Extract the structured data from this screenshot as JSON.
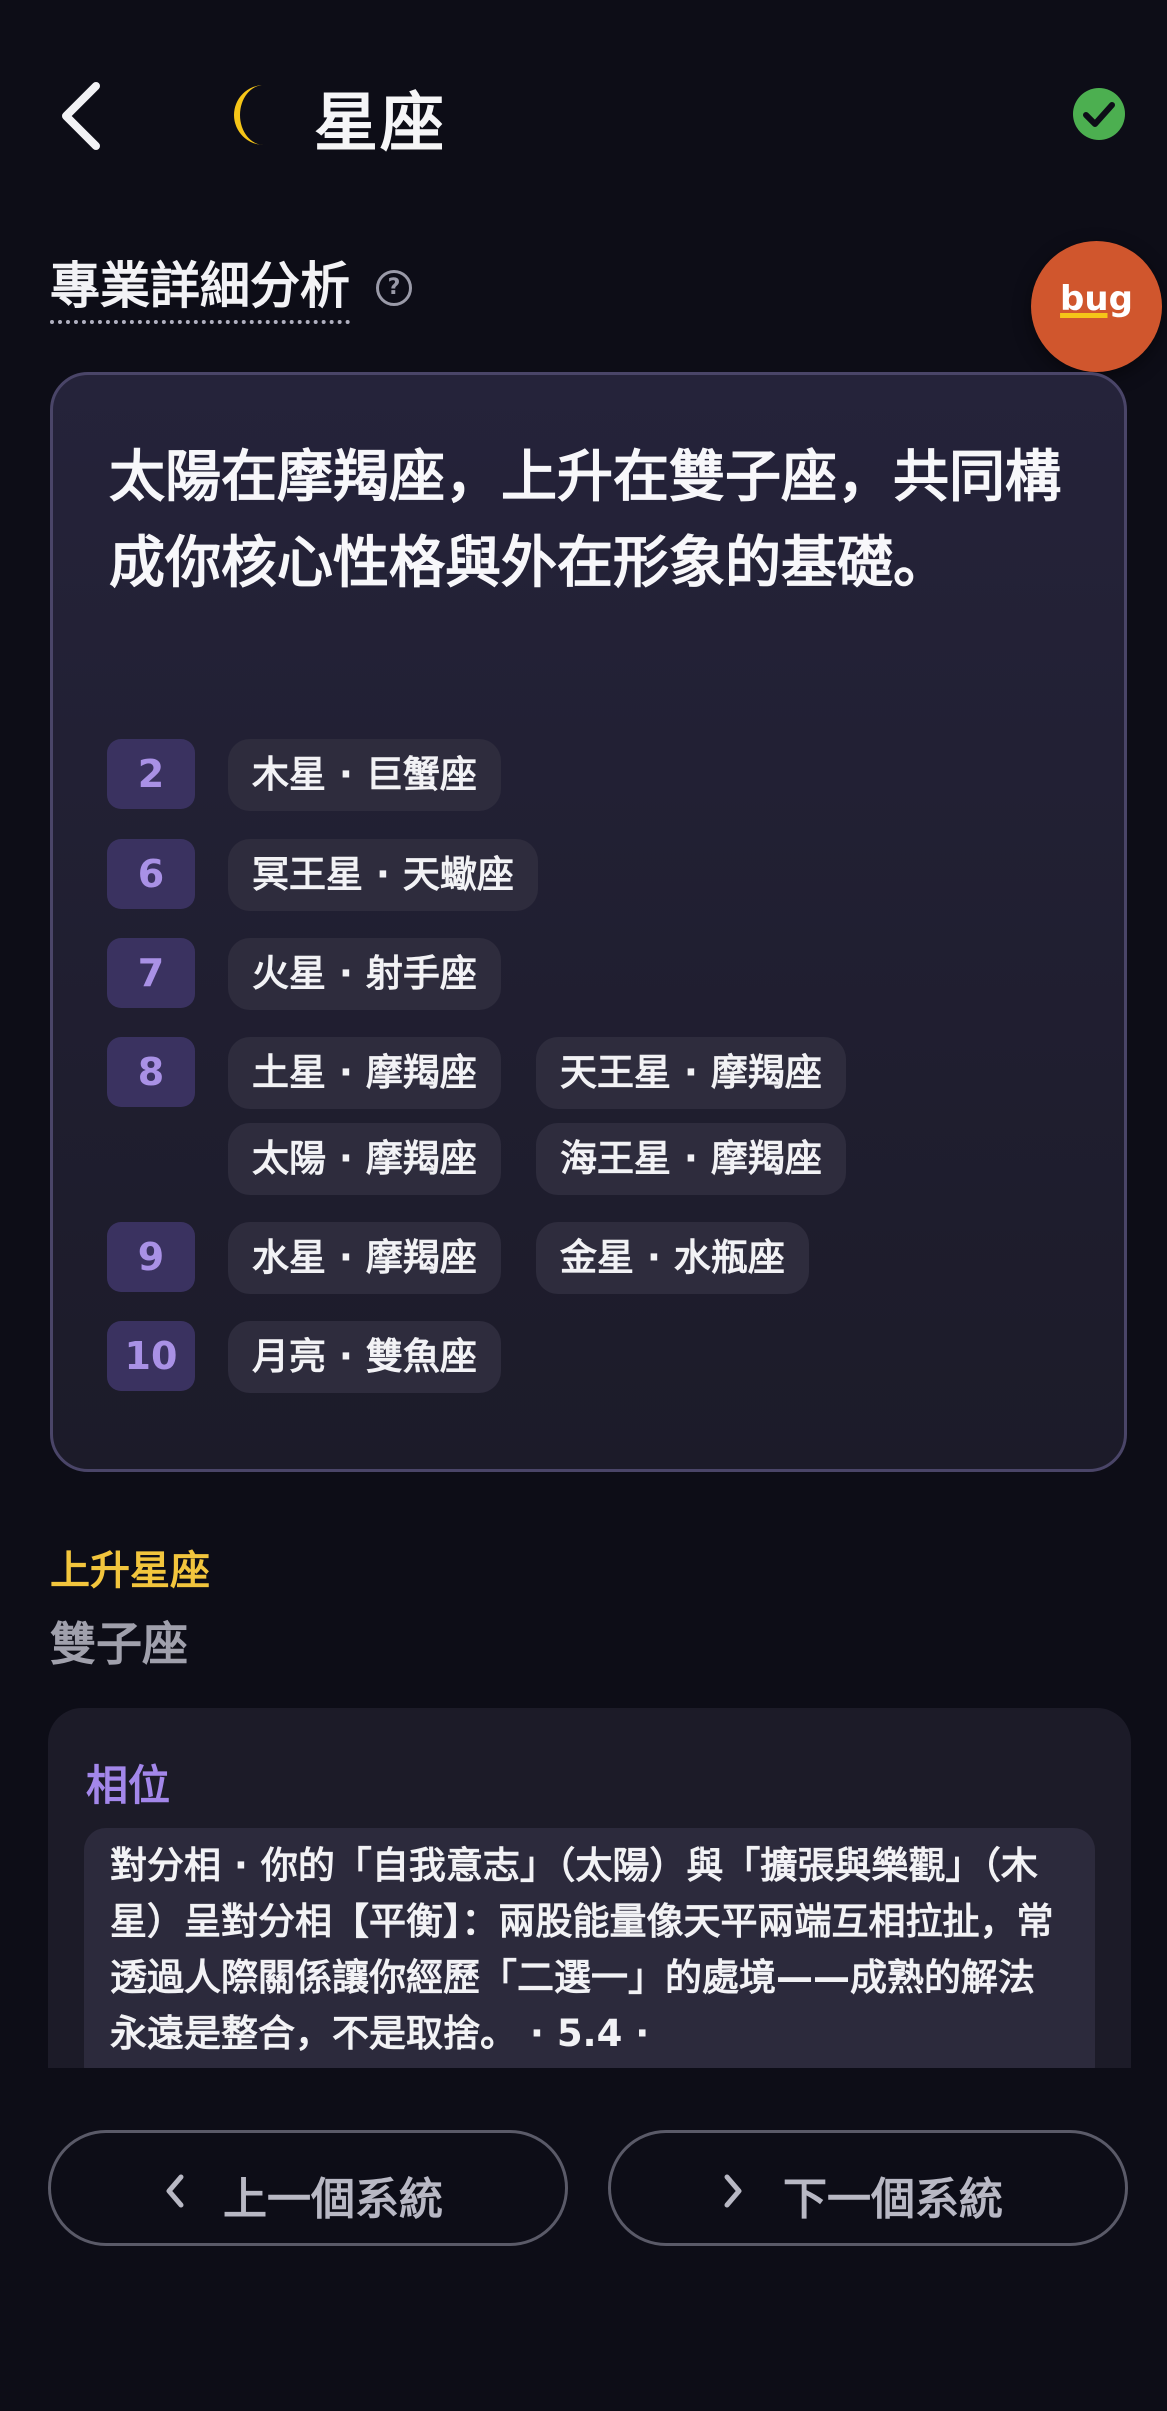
{
  "header": {
    "title": "星座",
    "back_icon": "chevron-left-icon",
    "moon_icon": "crescent-moon-icon",
    "status_icon": "check-circle-icon",
    "accent_color": "#f5c518",
    "status_color": "#4caf50"
  },
  "section": {
    "title": "專業詳細分析",
    "help_glyph": "?"
  },
  "bug_button": {
    "label": "bug",
    "color": "#d0562d"
  },
  "summary": {
    "headline": "太陽在摩羯座，上升在雙子座，共同構成你核心性格與外在形象的基礎。",
    "houses": [
      {
        "number": "2",
        "placements": [
          "木星 · 巨蟹座"
        ]
      },
      {
        "number": "6",
        "placements": [
          "冥王星 · 天蠍座"
        ]
      },
      {
        "number": "7",
        "placements": [
          "火星 · 射手座"
        ]
      },
      {
        "number": "8",
        "placements": [
          "土星 · 摩羯座",
          "天王星 · 摩羯座",
          "太陽 · 摩羯座",
          "海王星 · 摩羯座"
        ]
      },
      {
        "number": "9",
        "placements": [
          "水星 · 摩羯座",
          "金星 · 水瓶座"
        ]
      },
      {
        "number": "10",
        "placements": [
          "月亮 · 雙魚座"
        ]
      }
    ]
  },
  "rising": {
    "label": "上升星座",
    "value": "雙子座",
    "label_color": "#f2c53d"
  },
  "aspects": {
    "label": "相位",
    "label_color": "#a387ea",
    "text": "對分相 · 你的「自我意志」（太陽）與「擴張與樂觀」（木星）呈對分相【平衡】：兩股能量像天平兩端互相拉扯，常透過人際關係讓你經歷「二選一」的處境——成熟的解法永遠是整合，不是取捨。 · 5.4 ·"
  },
  "nav": {
    "prev_label": "上一個系統",
    "next_label": "下一個系統",
    "prev_icon": "chevron-left-icon",
    "next_icon": "chevron-right-icon"
  }
}
